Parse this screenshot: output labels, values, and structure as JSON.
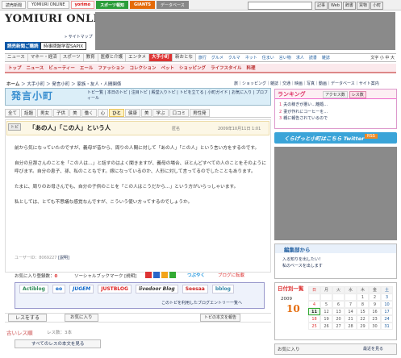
{
  "topbar": {
    "tabs": [
      "読売新聞",
      "YOMIURI ONLINE",
      "yorimo",
      "スポーツ報知",
      "GIANTS",
      "データベース"
    ],
    "buttons": [
      "記事",
      "Web",
      "辞書",
      "買物",
      "小町"
    ]
  },
  "header": {
    "logo": "YOMIURI ONLINE",
    "sitemap": "» サイトマップ",
    "login": "読売新聞ご購読",
    "sapix": "時事問題学習SAPIX"
  },
  "nav1": {
    "items": [
      "ニュース",
      "マネー・経済",
      "スポーツ",
      "教育",
      "医療と介護",
      "エンタメ",
      "大手小町",
      "新おとな"
    ],
    "active": "大手小町",
    "subs": [
      "旅行",
      "グルメ",
      "クルマ",
      "ネット",
      "住まい",
      "言い物",
      "求人",
      "読書",
      "雑誌"
    ],
    "font_size": "文字 小 中 大"
  },
  "nav2": {
    "items": [
      "トップ",
      "ニュース",
      "ビューティー",
      "エール",
      "ファッション",
      "コレクション",
      "ペット",
      "ショッピング",
      "ライフスタイル",
      "料理"
    ]
  },
  "breadcrumb": {
    "home": "ホーム",
    "path": " ＞ 大手小町 ＞ 発言小町 ＞ 家族・友人・人間関係",
    "right": "旅｜ショッピング｜雑誌｜交通｜映画｜写真｜動画｜データベース｜サイト案内"
  },
  "komachi": {
    "title": "発言小町",
    "links": "トピ一覧 | 本日のトピ | 注目トピ | 殿堂入りトピ | トピを立てる | 小町ガイド | お気に入り | プロフィール"
  },
  "categories": [
    "全て",
    "話題",
    "男女",
    "子供",
    "美",
    "働く",
    "心",
    "ひと",
    "健康",
    "美",
    "学ぶ",
    "口コミ",
    "男性発"
  ],
  "category_active": "ひと",
  "topic": {
    "badge": "トピ",
    "title": "「あの人」「この人」という人",
    "author": "匿名",
    "date": "2009年10月11日 1:01",
    "paragraphs": [
      "前から気になっていたのですが、義母が昔から、周りの人間に対して「あの人」「この人」という言い方をするのです。",
      "自分の旦那さんのことを「この人は…」と話すのはよく聞きますが、義母の場合、ほとんどすべての人のことをそのように呼びます。自分の息子、孫、私のこともです。嫁になっているのか、人形に対して言ってるのでしたこともあります。",
      "たまに、周りのお母さんでも、自分の子供のことを「この人はこうだから…」という方がいらっしゃいます。",
      "私としては、とても不思議な感覚なんですが、こういう使い方ってするのでしょうか。"
    ],
    "user_id": "ユーザーID：8069227",
    "report": "[説明]"
  },
  "actions": {
    "fav_label": "お気に入り登録数：",
    "fav_count": "0",
    "social": "ソーシャルブックマーク [説明]",
    "tweet": "つぶやく",
    "blogpost": "ブログに転載",
    "res_button": "レスをする",
    "fav_button": "お気に入り",
    "report_button": "トピの本文を報告"
  },
  "blogs": {
    "services": [
      "Actiblog",
      "eo",
      "JUGEM",
      "JUSTBLOG",
      "livedoor Blog",
      "Seesaa",
      "bblog"
    ],
    "note": "このトピを利用したブログエントリー一覧へ"
  },
  "responses": {
    "header": "古いレス順",
    "count": "レス数：3本",
    "show_all": "すべてのレスの本文を見る"
  },
  "ranking": {
    "title": "ランキング",
    "tabs": [
      "アクセス数",
      "レス数"
    ],
    "active_tab": "レス数",
    "items": [
      "夫の稼ぎが悪い…離婚…",
      "妻が作れにコーヒーを…",
      "親に報告されているので"
    ]
  },
  "twitter": {
    "text": "くらげっと小町はこちら Twitter",
    "rss": "RSS"
  },
  "editor": {
    "title": "編集部から",
    "items": [
      "入る知りを出したい！",
      "私のベースを出します"
    ]
  },
  "calendar": {
    "title": "日付別一覧",
    "year": "2009",
    "month": "10",
    "headers": [
      "日",
      "月",
      "火",
      "水",
      "木",
      "金",
      "土"
    ],
    "rows": [
      [
        "",
        "",
        "",
        "",
        "1",
        "2",
        "3"
      ],
      [
        "4",
        "5",
        "6",
        "7",
        "8",
        "9",
        "10"
      ],
      [
        "11",
        "12",
        "13",
        "14",
        "15",
        "16",
        "17"
      ],
      [
        "18",
        "19",
        "20",
        "21",
        "22",
        "23",
        "24"
      ],
      [
        "25",
        "26",
        "27",
        "28",
        "29",
        "30",
        "31"
      ]
    ],
    "today": "11"
  },
  "favorites": {
    "title": "お気に入り",
    "link": "最近を見る"
  }
}
